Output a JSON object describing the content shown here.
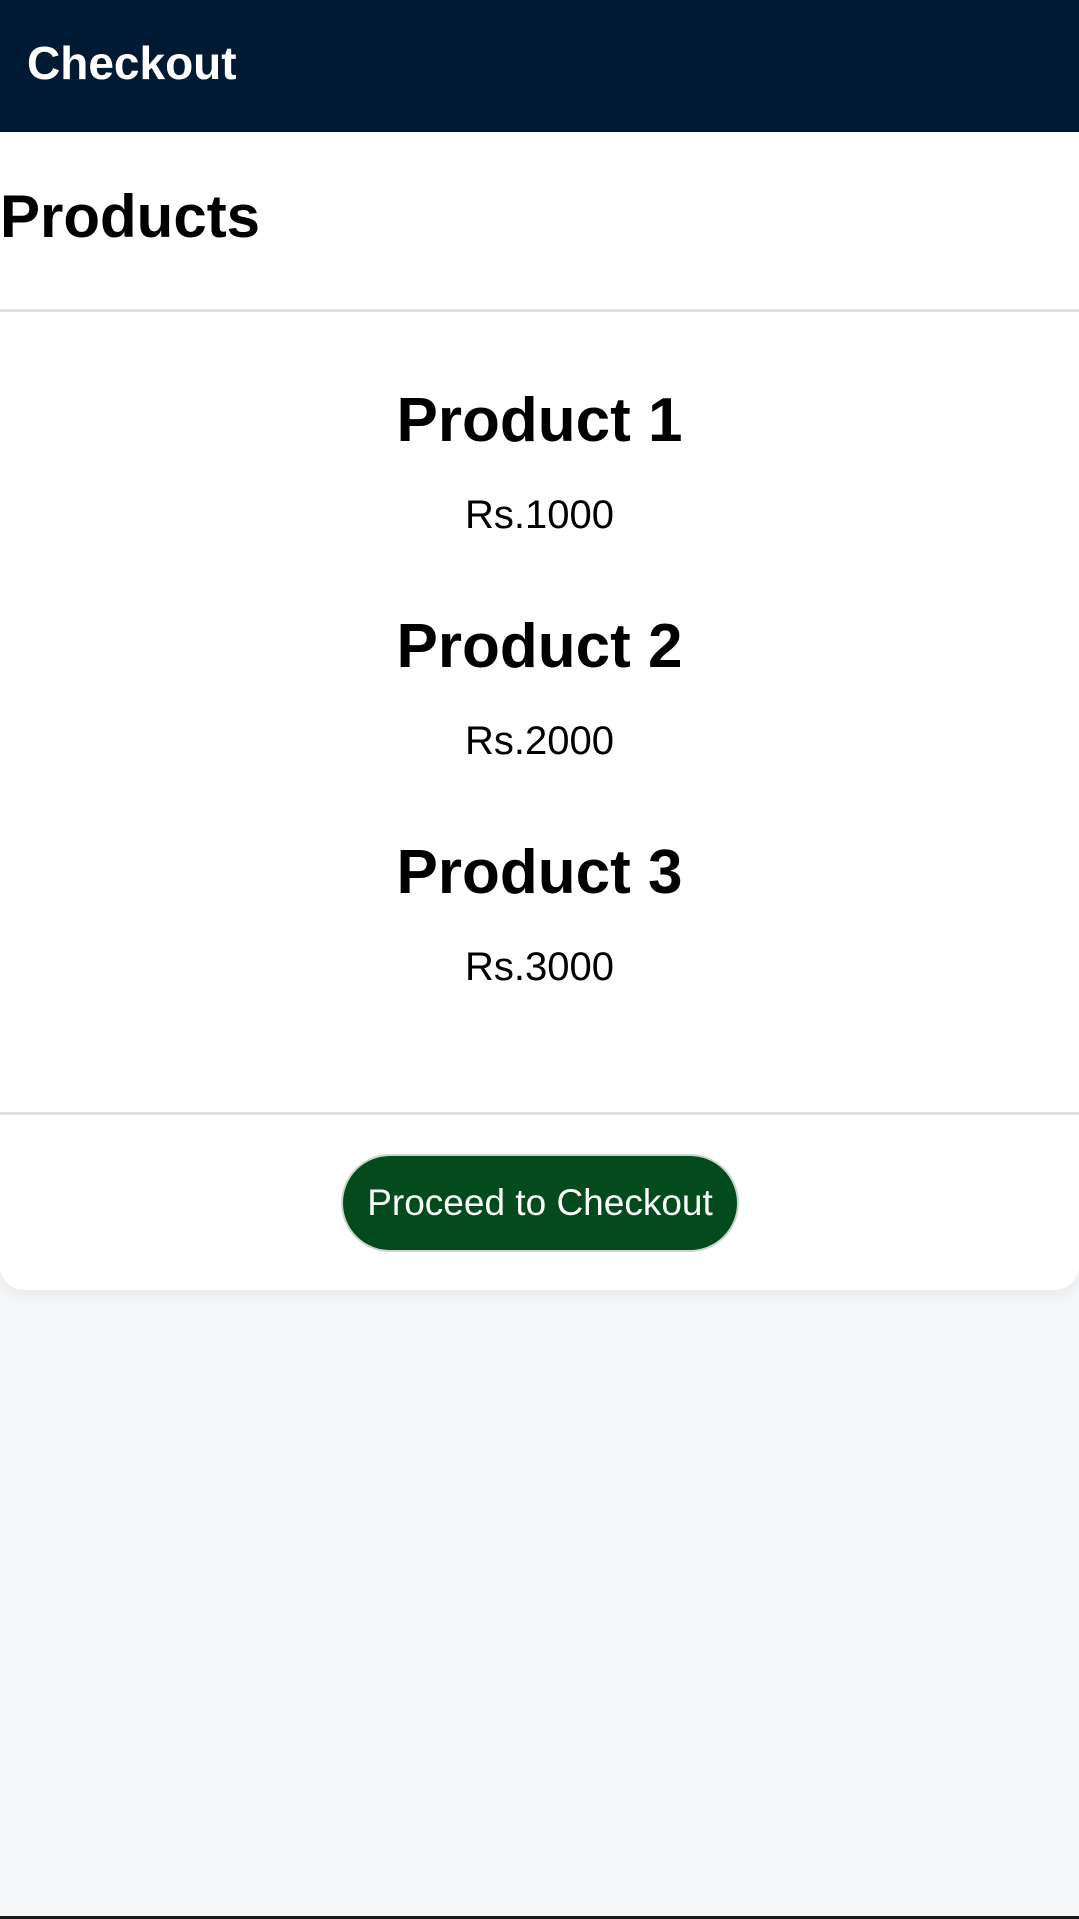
{
  "header": {
    "title": "Checkout"
  },
  "products_section": {
    "title": "Products",
    "items": [
      {
        "name": "Product 1",
        "price": "Rs.1000"
      },
      {
        "name": "Product 2",
        "price": "Rs.2000"
      },
      {
        "name": "Product 3",
        "price": "Rs.3000"
      }
    ]
  },
  "actions": {
    "checkout_label": "Proceed to Checkout"
  },
  "colors": {
    "header_background": "#001a33",
    "button_background": "#034b1c",
    "page_background": "#f6f7f9"
  }
}
